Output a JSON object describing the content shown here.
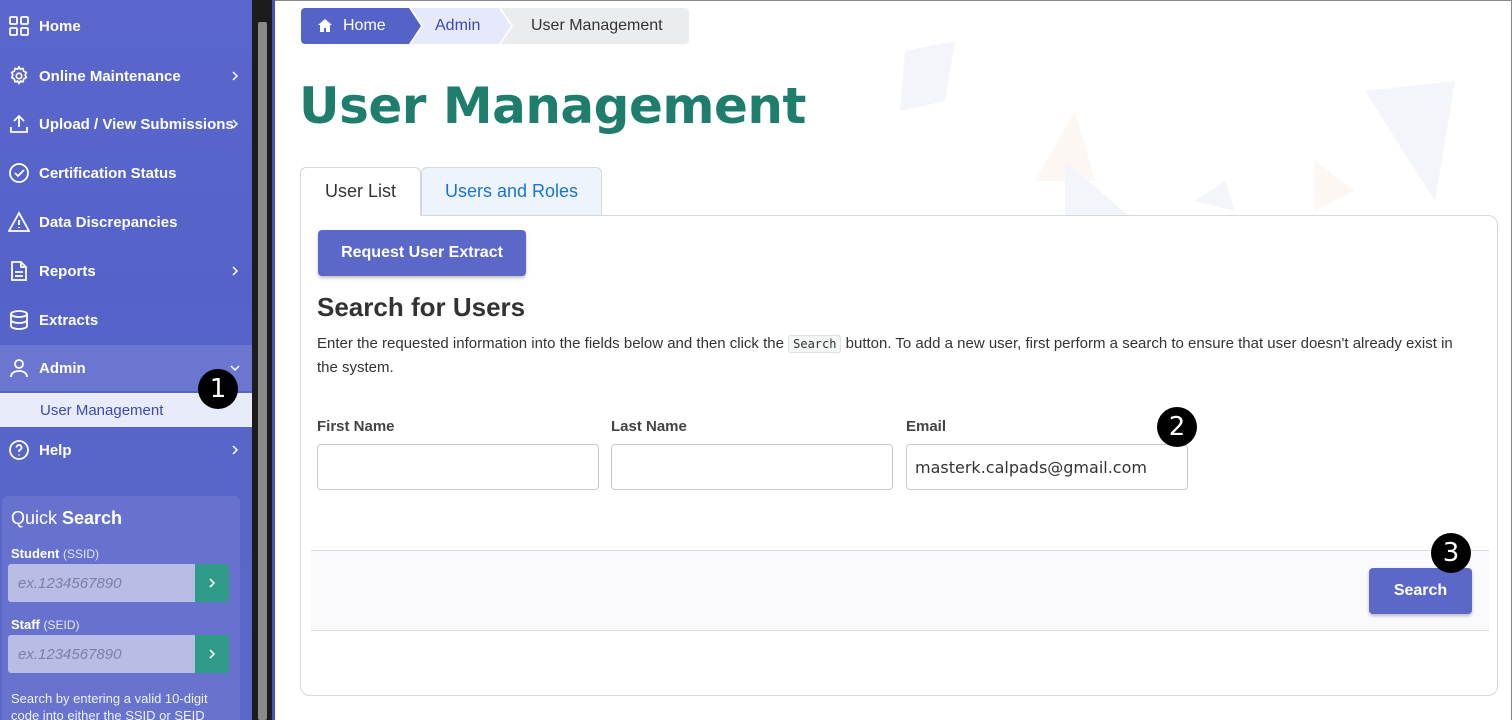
{
  "sidebar": {
    "items": [
      {
        "label": "Home",
        "icon": "grid-icon",
        "has_chevron": false
      },
      {
        "label": "Online Maintenance",
        "icon": "gear-icon",
        "has_chevron": true
      },
      {
        "label": "Upload / View Submissions",
        "icon": "upload-icon",
        "has_chevron": true
      },
      {
        "label": "Certification Status",
        "icon": "check-circle-icon",
        "has_chevron": false
      },
      {
        "label": "Data Discrepancies",
        "icon": "warning-icon",
        "has_chevron": false
      },
      {
        "label": "Reports",
        "icon": "document-icon",
        "has_chevron": true
      },
      {
        "label": "Extracts",
        "icon": "database-icon",
        "has_chevron": false
      },
      {
        "label": "Admin",
        "icon": "user-icon",
        "has_chevron": true
      },
      {
        "label": "Help",
        "icon": "help-icon",
        "has_chevron": true
      }
    ],
    "submenu_label": "User Management",
    "quick_search": {
      "title_light": "Quick ",
      "title_bold": "Search",
      "student_label": "Student",
      "student_sub": "(SSID)",
      "student_placeholder": "ex.1234567890",
      "staff_label": "Staff",
      "staff_sub": "(SEID)",
      "staff_placeholder": "ex.1234567890",
      "help_text": "Search by entering a valid 10-digit code into either the SSID or SEID"
    }
  },
  "breadcrumb": {
    "home": "Home",
    "admin": "Admin",
    "current": "User Management"
  },
  "page_title": "User Management",
  "tabs": [
    {
      "label": "User List",
      "active": true
    },
    {
      "label": "Users and Roles",
      "active": false
    }
  ],
  "panel": {
    "extract_button": "Request User Extract",
    "search_heading": "Search for Users",
    "instructions_before": "Enter the requested information into the fields below and then click the ",
    "instructions_code": "Search",
    "instructions_after": " button. To add a new user, first perform a search to ensure that user doesn't already exist in the system.",
    "fields": {
      "first_name_label": "First Name",
      "first_name_value": "",
      "last_name_label": "Last Name",
      "last_name_value": "",
      "email_label": "Email",
      "email_value": "masterk.calpads@gmail.com"
    },
    "search_button": "Search"
  },
  "markers": [
    "1",
    "2",
    "3"
  ],
  "colors": {
    "sidebar_bg": "#5563c9",
    "primary_button": "#5c68c8",
    "title_green": "#1e7d6c",
    "link_blue": "#1a73d1",
    "quick_search_go": "#2e9a87"
  }
}
